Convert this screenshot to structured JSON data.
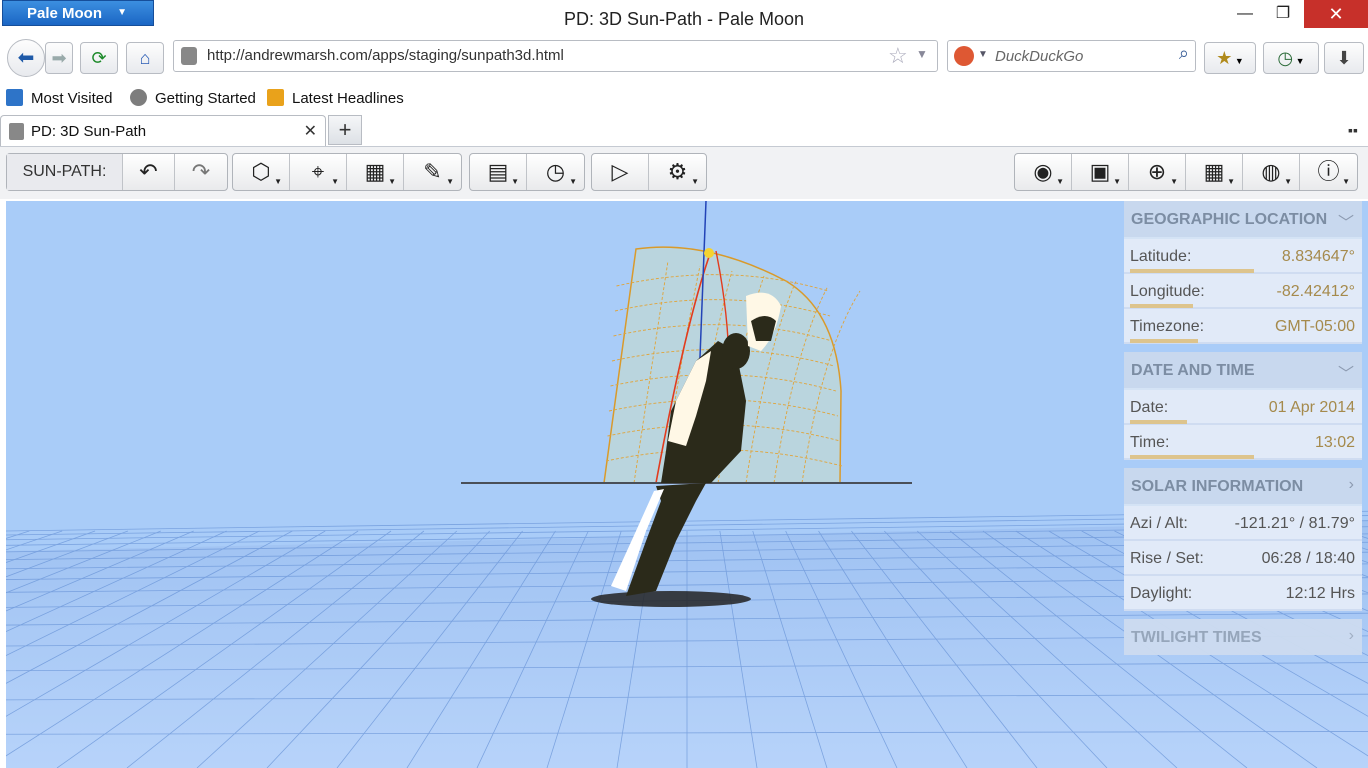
{
  "window": {
    "app_menu": "Pale Moon",
    "title": "PD: 3D Sun-Path - Pale Moon",
    "minimize": "—",
    "maximize": "❐",
    "close": "✕"
  },
  "nav": {
    "url": "http://andrewmarsh.com/apps/staging/sunpath3d.html",
    "search_placeholder": "DuckDuckGo"
  },
  "bookmarks": [
    "Most Visited",
    "Getting Started",
    "Latest Headlines"
  ],
  "tabs": {
    "active_title": "PD: 3D Sun-Path",
    "close": "✕",
    "new": "+"
  },
  "toolbar": {
    "label": "SUN-PATH:"
  },
  "panel": {
    "geo": {
      "title": "GEOGRAPHIC LOCATION",
      "latitude_label": "Latitude:",
      "latitude": "8.834647°",
      "longitude_label": "Longitude:",
      "longitude": "-82.42412°",
      "timezone_label": "Timezone:",
      "timezone": "GMT-05:00"
    },
    "datetime": {
      "title": "DATE AND TIME",
      "date_label": "Date:",
      "date": "01 Apr 2014",
      "time_label": "Time:",
      "time": "13:02"
    },
    "solar": {
      "title": "SOLAR INFORMATION",
      "azi_label": "Azi / Alt:",
      "azi": "-121.21° / 81.79°",
      "rise_label": "Rise / Set:",
      "rise": "06:28 / 18:40",
      "daylight_label": "Daylight:",
      "daylight": "12:12 Hrs"
    },
    "twilight": {
      "title": "TWILIGHT TIMES"
    }
  },
  "colors": {
    "sky": "#a9ccf8",
    "grid": "#6a95d8",
    "sunpath": "#e5a83a",
    "panel_value": "#a58a4c",
    "close": "#c7302a",
    "accent_blue": "#1b66c4"
  },
  "slider_levels": {
    "latitude": 0.55,
    "longitude": 0.28,
    "timezone": 0.3,
    "date": 0.25,
    "time": 0.55
  }
}
